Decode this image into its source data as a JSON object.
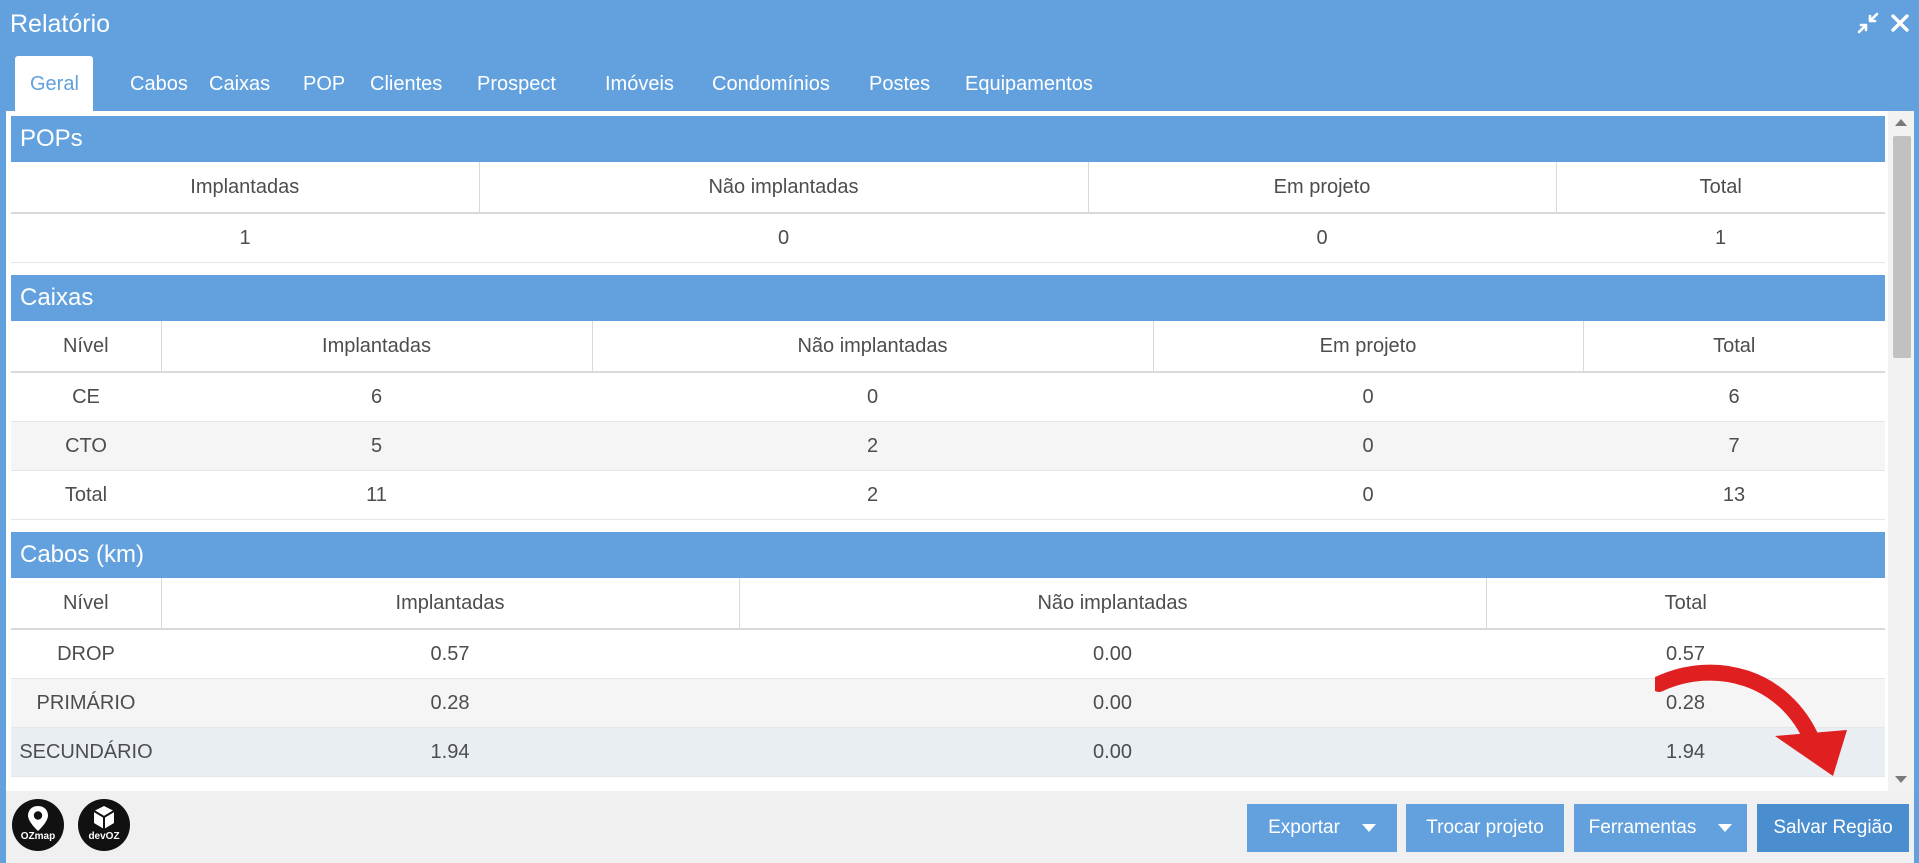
{
  "window": {
    "title": "Relatório"
  },
  "tabs": [
    {
      "label": "Geral",
      "active": true
    },
    {
      "label": "Cabos"
    },
    {
      "label": "Caixas"
    },
    {
      "label": "POP"
    },
    {
      "label": "Clientes"
    },
    {
      "label": "Prospect"
    },
    {
      "label": "Imóveis"
    },
    {
      "label": "Condomínios"
    },
    {
      "label": "Postes"
    },
    {
      "label": "Equipamentos"
    }
  ],
  "pops": {
    "title": "POPs",
    "headers": [
      "Implantadas",
      "Não implantadas",
      "Em projeto",
      "Total"
    ],
    "rows": [
      [
        "1",
        "0",
        "0",
        "1"
      ]
    ]
  },
  "caixas": {
    "title": "Caixas",
    "headers": [
      "Nível",
      "Implantadas",
      "Não implantadas",
      "Em projeto",
      "Total"
    ],
    "rows": [
      [
        "CE",
        "6",
        "0",
        "0",
        "6"
      ],
      [
        "CTO",
        "5",
        "2",
        "0",
        "7"
      ],
      [
        "Total",
        "11",
        "2",
        "0",
        "13"
      ]
    ]
  },
  "cabos": {
    "title": "Cabos (km)",
    "headers": [
      "Nível",
      "Implantadas",
      "Não implantadas",
      "Total"
    ],
    "rows": [
      [
        "DROP",
        "0.57",
        "0.00",
        "0.57"
      ],
      [
        "PRIMÁRIO",
        "0.28",
        "0.00",
        "0.28"
      ],
      [
        "SECUNDÁRIO",
        "1.94",
        "0.00",
        "1.94"
      ]
    ]
  },
  "footer": {
    "logos": [
      {
        "icon": "ozmap-logo-icon",
        "text": "OZmap"
      },
      {
        "icon": "devoz-logo-icon",
        "text": "devOZ"
      }
    ],
    "buttons": {
      "exportar": "Exportar",
      "trocar_projeto": "Trocar projeto",
      "ferramentas": "Ferramentas",
      "salvar_regiao": "Salvar Região"
    }
  },
  "colors": {
    "accent": "#62a1dd",
    "annotation_arrow": "#e02020"
  }
}
